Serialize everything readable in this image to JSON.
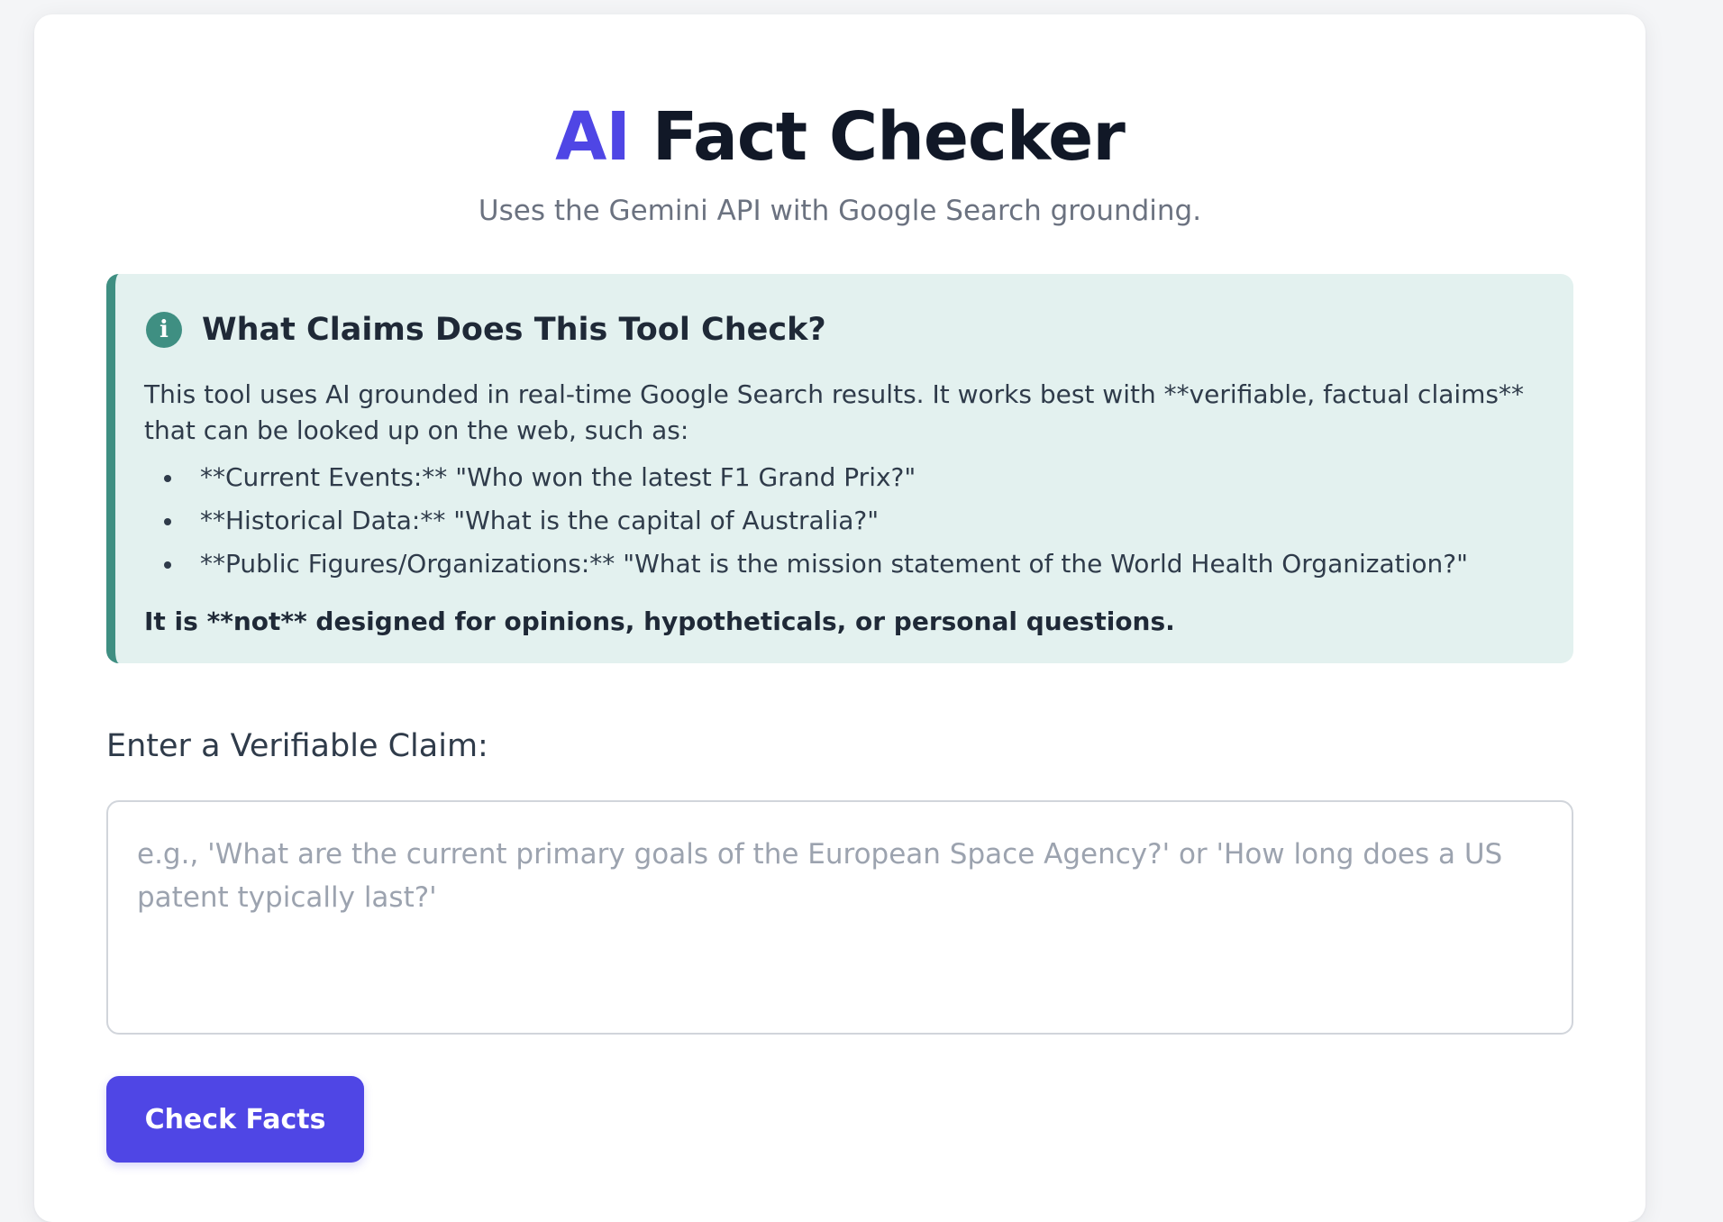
{
  "header": {
    "title_accent": "AI",
    "title_rest": " Fact Checker",
    "subtitle": "Uses the Gemini API with Google Search grounding."
  },
  "info": {
    "icon": "info-icon",
    "icon_glyph": "i",
    "title": "What Claims Does This Tool Check?",
    "description": "This tool uses AI grounded in real-time Google Search results. It works best with **verifiable, factual claims** that can be looked up on the web, such as:",
    "examples": [
      "**Current Events:** \"Who won the latest F1 Grand Prix?\"",
      "**Historical Data:** \"What is the capital of Australia?\"",
      "**Public Figures/Organizations:** \"What is the mission statement of the World Health Organization?\""
    ],
    "note": "It is **not** designed for opinions, hypotheticals, or personal questions."
  },
  "form": {
    "label": "Enter a Verifiable Claim:",
    "value": "",
    "placeholder": "e.g., 'What are the current primary goals of the European Space Agency?' or 'How long does a US patent typically last?'",
    "submit_label": "Check Facts"
  },
  "colors": {
    "accent": "#4f46e5",
    "info_bg": "#e3f1ef",
    "info_border": "#3f8f82",
    "page_bg": "#f4f5f7"
  }
}
